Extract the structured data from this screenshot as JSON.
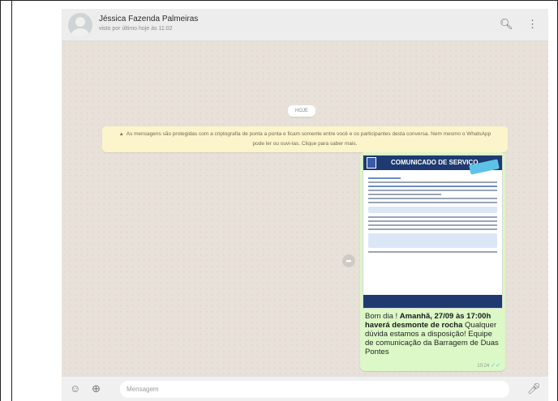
{
  "header": {
    "contact_name": "Jéssica Fazenda Palmeiras",
    "status": "visto por último hoje às 11:02",
    "icons": [
      "search-icon",
      "menu-icon"
    ]
  },
  "chat": {
    "date_label": "HOJE",
    "encryption_notice": "As mensagens são protegidas com a criptografia de ponta a ponta e ficam somente entre você e os participantes desta conversa. Nem mesmo o WhatsApp pode ler ou ouvi-las. Clique para saber mais.",
    "message": {
      "image_title": "COMUNICADO DE SERVIÇO",
      "text_greeting": "Bom dia ! ",
      "text_bold": "Amanhã, 27/09 às 17:00h haverá desmonte de rocha",
      "text_rest": " Qualquer dúvida estamos a disposição! Equipe de comunicação da Barragem de Duas Pontes",
      "time": "10:24",
      "check": "✓✓"
    }
  },
  "composer": {
    "placeholder": "Mensagem",
    "icons": [
      "emoji-icon",
      "attach-icon",
      "mic-icon"
    ]
  },
  "colors": {
    "chat_background": "#e8e1d9",
    "outgoing_bubble": "#dcf8c6",
    "notice_background": "#fcf4cb",
    "header_background": "#ededed"
  }
}
